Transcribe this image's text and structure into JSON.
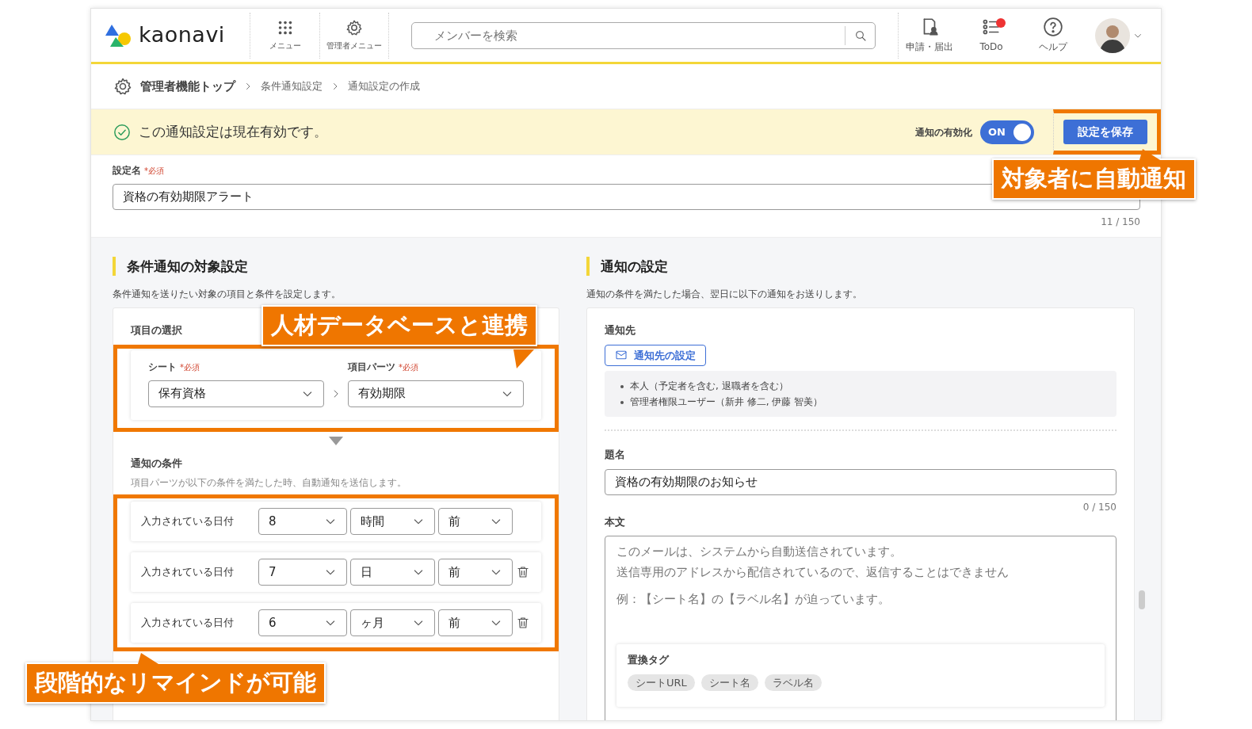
{
  "header": {
    "logo_text": "kaonavi",
    "nav": [
      {
        "label": "メニュー",
        "kind": "grid"
      },
      {
        "label": "管理者メニュー",
        "kind": "gear"
      }
    ],
    "search": {
      "placeholder": "メンバーを検索"
    },
    "tools": [
      {
        "label": "申請・届出",
        "kind": "form",
        "alert": false
      },
      {
        "label": "ToDo",
        "kind": "todo",
        "alert": true
      },
      {
        "label": "ヘルプ",
        "kind": "help",
        "alert": false
      }
    ]
  },
  "breadcrumb": [
    "管理者機能トップ",
    "条件通知設定",
    "通知設定の作成"
  ],
  "banner": {
    "message": "この通知設定は現在有効です。",
    "toggle_label": "通知の有効化",
    "toggle": {
      "text": "ON",
      "on": true
    },
    "save_button": "設定を保存",
    "highlighted": true
  },
  "setting_name": {
    "label": "設定名",
    "required": "*必須",
    "value": "資格の有効期限アラート",
    "counter": "11 / 150"
  },
  "target": {
    "title": "条件通知の対象設定",
    "description": "条件通知を送りたい対象の項目と条件を設定します。",
    "selection_label": "項目の選択",
    "selection_highlighted": true,
    "selects": [
      {
        "label": "シート",
        "required": "*必須",
        "value": "保有資格"
      },
      {
        "label": "項目パーツ",
        "required": "*必須",
        "value": "有効期限"
      }
    ],
    "conditions_label": "通知の条件",
    "conditions_description": "項目パーツが以下の条件を満たした時、自動通知を送信します。",
    "conditions_highlighted": true,
    "conditions": [
      {
        "label": "入力されている日付",
        "number": "8",
        "unit": "時間",
        "direction": "前",
        "deletable": false
      },
      {
        "label": "入力されている日付",
        "number": "7",
        "unit": "日",
        "direction": "前",
        "deletable": true
      },
      {
        "label": "入力されている日付",
        "number": "6",
        "unit": "ヶ月",
        "direction": "前",
        "deletable": true
      }
    ]
  },
  "notify": {
    "title": "通知の設定",
    "description": "通知の条件を満たした場合、翌日に以下の通知をお送りします。",
    "recipients_label": "通知先",
    "recipients_button": "通知先の設定",
    "recipients": [
      "本人（予定者を含む, 退職者を含む）",
      "管理者権限ユーザー（新井 修二, 伊藤 智美）"
    ],
    "subject_label": "題名",
    "subject": "資格の有効期限のお知らせ",
    "subject_counter": "0 / 150",
    "body_label": "本文",
    "body_placeholder": [
      "このメールは、システムから自動送信されています。",
      "送信専用のアドレスから配信されているので、返信することはできません",
      "例：【シート名】の【ラベル名】が迫っています。"
    ],
    "tags_label": "置換タグ",
    "tags": [
      "シートURL",
      "シート名",
      "ラベル名"
    ]
  },
  "callouts": [
    "人材データベースと連携",
    "段階的なリマインドが可能",
    "対象者に自動通知"
  ]
}
